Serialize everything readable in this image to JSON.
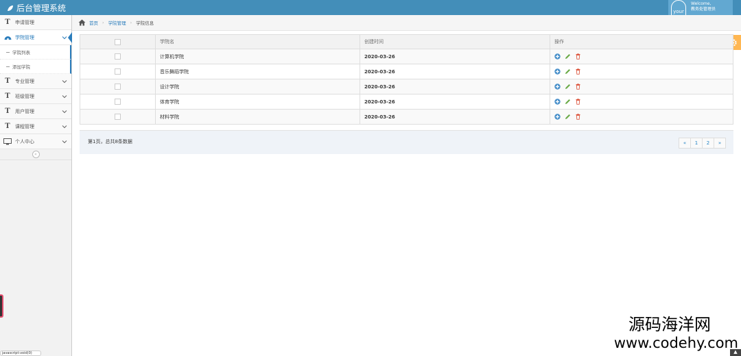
{
  "app": {
    "title": "后台管理系统"
  },
  "user": {
    "avatar_text": "your",
    "welcome": "Welcome,",
    "name": "教务处管理员"
  },
  "sidebar": {
    "items": [
      {
        "label": "申请管理",
        "icon": "text-icon"
      },
      {
        "label": "学院管理",
        "icon": "dashboard-icon",
        "active": true
      },
      {
        "label": "专业管理",
        "icon": "text-icon"
      },
      {
        "label": "班级管理",
        "icon": "text-icon"
      },
      {
        "label": "用户管理",
        "icon": "text-icon"
      },
      {
        "label": "课程管理",
        "icon": "text-icon"
      },
      {
        "label": "个人中心",
        "icon": "desktop-icon"
      }
    ],
    "subitems": [
      {
        "label": "学院列表"
      },
      {
        "label": "添加学院"
      }
    ],
    "collapse_label": "«"
  },
  "breadcrumb": {
    "home": "首页",
    "section": "学院管理",
    "current": "学院信息"
  },
  "table": {
    "columns": [
      "",
      "学院名",
      "创建时间",
      "操作"
    ],
    "rows": [
      {
        "name": "计算机学院",
        "date": "2020-03-26"
      },
      {
        "name": "音乐舞蹈学院",
        "date": "2020-03-26"
      },
      {
        "name": "设计学院",
        "date": "2020-03-26"
      },
      {
        "name": "体育学院",
        "date": "2020-03-26"
      },
      {
        "name": "材料学院",
        "date": "2020-03-26"
      }
    ]
  },
  "pagination": {
    "info": "第1页，总共8条数据",
    "prev": "«",
    "pages": [
      "1",
      "2"
    ],
    "next": "»"
  },
  "watermark": {
    "line1": "源码海洋网",
    "line2": "www.codehy.com"
  },
  "status_url": "javascript:void(0)",
  "colors": {
    "topbar": "#438eb9",
    "accent": "#2b7dbc",
    "gear": "#ffb752",
    "add": "#478fca",
    "edit": "#69aa46",
    "delete": "#dd5a43"
  }
}
